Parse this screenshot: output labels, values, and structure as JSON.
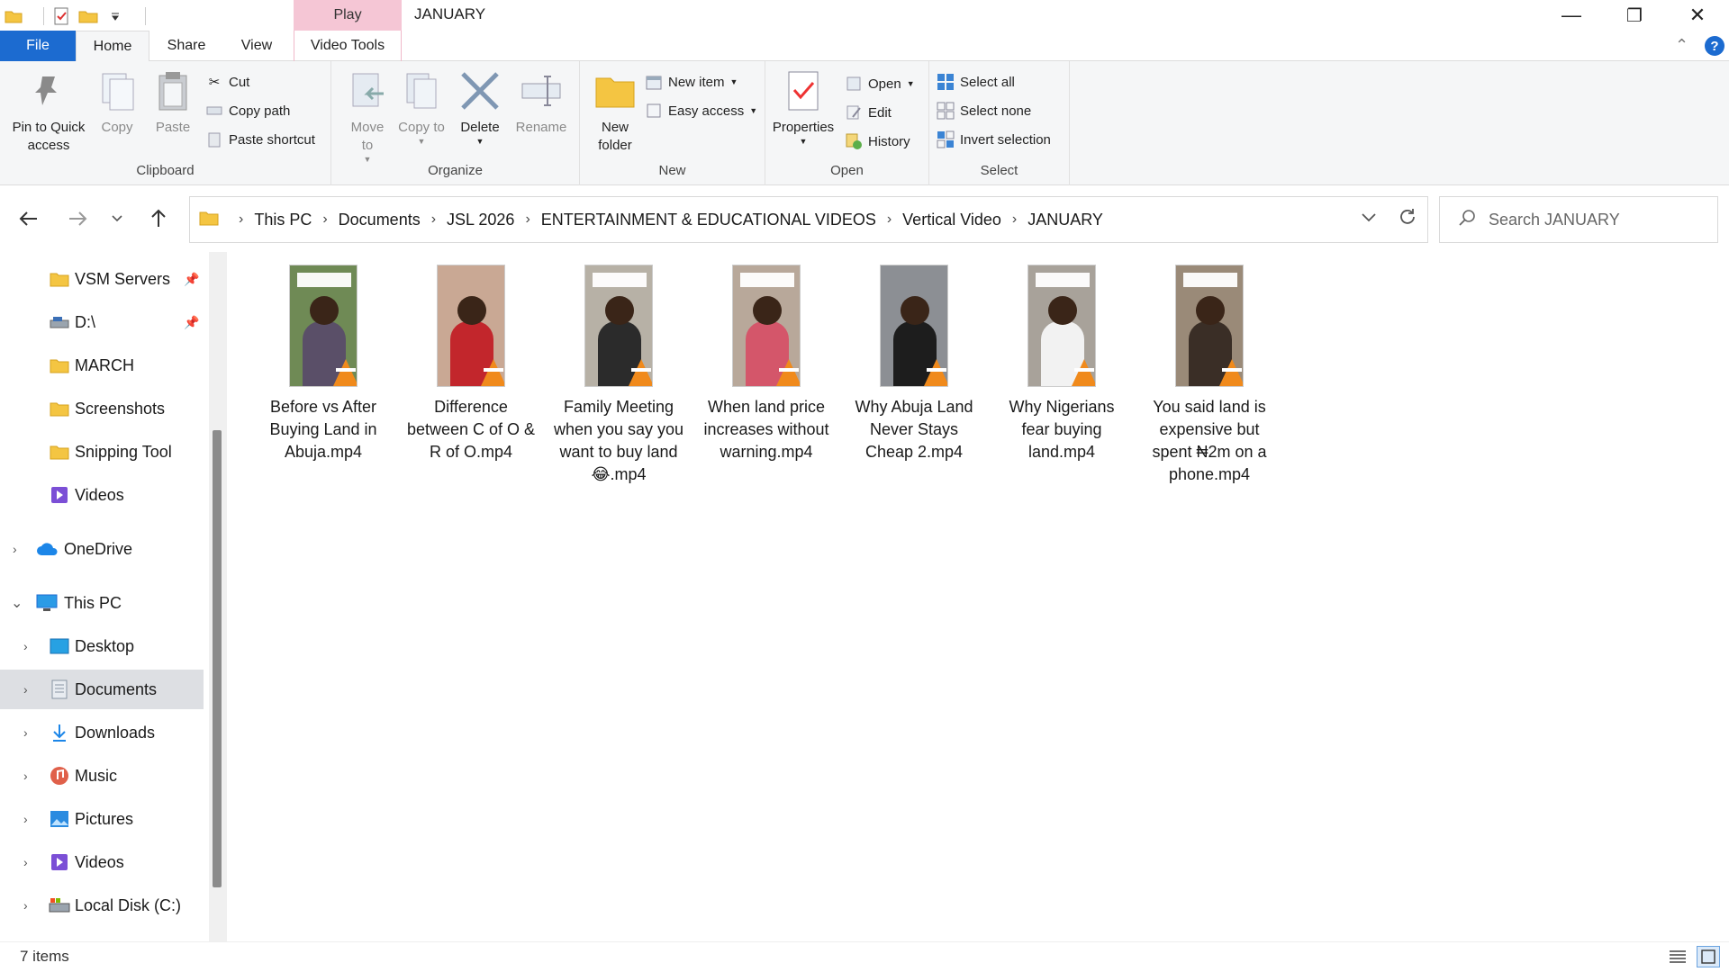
{
  "window": {
    "title": "JANUARY",
    "context_tab": "Play",
    "minimize": "—",
    "maximize": "❐",
    "close": "✕"
  },
  "tabs": [
    {
      "label": "File"
    },
    {
      "label": "Home"
    },
    {
      "label": "Share"
    },
    {
      "label": "View"
    },
    {
      "label": "Video Tools"
    }
  ],
  "ribbon": {
    "clipboard": {
      "label": "Clipboard",
      "pin": "Pin to Quick access",
      "copy": "Copy",
      "paste": "Paste",
      "cut": "Cut",
      "copy_path": "Copy path",
      "paste_shortcut": "Paste shortcut"
    },
    "organize": {
      "label": "Organize",
      "move_to": "Move to",
      "copy_to": "Copy to",
      "delete": "Delete",
      "rename": "Rename"
    },
    "new": {
      "label": "New",
      "new_folder": "New folder",
      "new_item": "New item",
      "easy_access": "Easy access"
    },
    "open": {
      "label": "Open",
      "properties": "Properties",
      "open": "Open",
      "edit": "Edit",
      "history": "History"
    },
    "select": {
      "label": "Select",
      "select_all": "Select all",
      "select_none": "Select none",
      "invert_selection": "Invert selection"
    }
  },
  "address": {
    "crumbs": [
      "This PC",
      "Documents",
      "JSL 2026",
      "ENTERTAINMENT & EDUCATIONAL VIDEOS",
      "Vertical Video",
      "JANUARY"
    ],
    "search_placeholder": "Search JANUARY"
  },
  "nav": [
    {
      "label": "VSM Servers",
      "icon": "folder-icon",
      "pinned": true
    },
    {
      "label": "D:\\",
      "icon": "drive-icon",
      "pinned": true
    },
    {
      "label": "MARCH",
      "icon": "folder-icon"
    },
    {
      "label": "Screenshots",
      "icon": "folder-icon"
    },
    {
      "label": "Snipping Tool",
      "icon": "folder-icon"
    },
    {
      "label": "Videos",
      "icon": "videos-icon"
    },
    {
      "label": "OneDrive",
      "icon": "cloud-icon"
    },
    {
      "label": "This PC",
      "icon": "computer-icon"
    },
    {
      "label": "Desktop",
      "icon": "desktop-icon"
    },
    {
      "label": "Documents",
      "icon": "documents-icon",
      "selected": true
    },
    {
      "label": "Downloads",
      "icon": "download-icon"
    },
    {
      "label": "Music",
      "icon": "music-icon"
    },
    {
      "label": "Pictures",
      "icon": "pictures-icon"
    },
    {
      "label": "Videos",
      "icon": "videos-icon"
    },
    {
      "label": "Local Disk (C:)",
      "icon": "disk-icon"
    }
  ],
  "files": [
    {
      "name": "Before vs After Buying Land in Abuja.mp4",
      "thumb_color": "#6f8a55",
      "outfit": "#5a4f68"
    },
    {
      "name": "Difference between C of O & R of O.mp4",
      "thumb_color": "#c9a894",
      "outfit": "#c2262c"
    },
    {
      "name": "Family Meeting when you say you want to buy land 😂.mp4",
      "thumb_color": "#b7b1a6",
      "outfit": "#2b2b2b"
    },
    {
      "name": "When land price increases without warning.mp4",
      "thumb_color": "#b8a89a",
      "outfit": "#d4566a"
    },
    {
      "name": "Why Abuja Land Never Stays Cheap 2.mp4",
      "thumb_color": "#8c8f94",
      "outfit": "#1d1d1d"
    },
    {
      "name": "Why Nigerians fear buying land.mp4",
      "thumb_color": "#a8a29a",
      "outfit": "#f2f2f2"
    },
    {
      "name": "You said land is expensive but spent ₦2m on a phone.mp4",
      "thumb_color": "#9a8a78",
      "outfit": "#3a2e26"
    }
  ],
  "status": {
    "count": "7 items"
  },
  "colors": {
    "accent": "#1c6bd0",
    "context_tab": "#f5c6d5",
    "folder": "#f4c542",
    "vlc": "#f08a1c"
  }
}
